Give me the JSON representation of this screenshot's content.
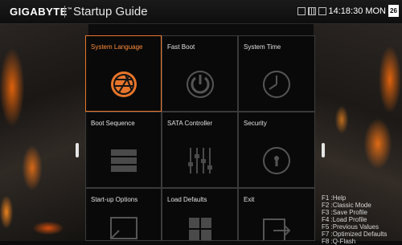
{
  "header": {
    "brand": "GIGABYTE",
    "brand_tm": "™",
    "title": "Startup Guide",
    "time": "14:18:30",
    "day": "MON",
    "date_day": "26"
  },
  "tiles": [
    {
      "label": "System Language",
      "icon": "globe-icon",
      "selected": true
    },
    {
      "label": "Fast Boot",
      "icon": "power-icon",
      "selected": false
    },
    {
      "label": "System Time",
      "icon": "clock-icon",
      "selected": false
    },
    {
      "label": "Boot Sequence",
      "icon": "drive-stack-icon",
      "selected": false
    },
    {
      "label": "SATA Controller",
      "icon": "sliders-icon",
      "selected": false
    },
    {
      "label": "Security",
      "icon": "lock-icon",
      "selected": false
    },
    {
      "label": "Start-up Options",
      "icon": "monitor-icon",
      "selected": false
    },
    {
      "label": "Load Defaults",
      "icon": "windows-icon",
      "selected": false
    },
    {
      "label": "Exit",
      "icon": "exit-icon",
      "selected": false
    }
  ],
  "help": [
    "F1 :Help",
    "F2 :Classic Mode",
    "F3 :Save Profile",
    "F4 :Load Profile",
    "F5 :Previous Values",
    "F7 :Optimized Defaults",
    "F8 :Q-Flash"
  ],
  "colors": {
    "accent": "#e8752a",
    "background": "#0c0c0c",
    "tile_border": "#3a3a3a"
  }
}
